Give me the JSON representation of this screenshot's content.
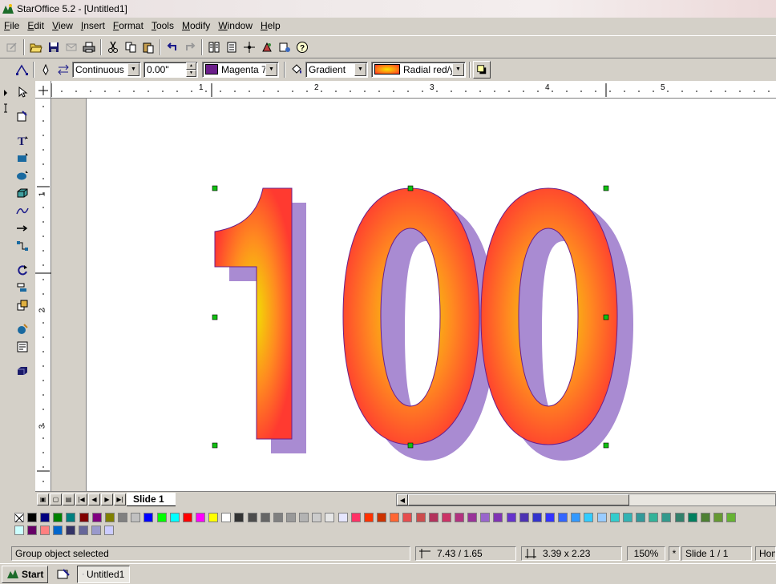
{
  "window": {
    "title": "StarOffice 5.2 - [Untitled1]"
  },
  "menu": {
    "items": [
      {
        "key": "F",
        "rest": "ile"
      },
      {
        "key": "E",
        "rest": "dit"
      },
      {
        "key": "V",
        "rest": "iew"
      },
      {
        "key": "I",
        "rest": "nsert"
      },
      {
        "key": "F",
        "rest": "ormat"
      },
      {
        "key": "T",
        "rest": "ools"
      },
      {
        "key": "M",
        "rest": "odify"
      },
      {
        "key": "W",
        "rest": "indow"
      },
      {
        "key": "H",
        "rest": "elp"
      }
    ]
  },
  "object_bar": {
    "line_style": "Continuous",
    "line_width": "0.00\"",
    "line_color": "Magenta 7",
    "line_color_hex": "#6b1e8a",
    "area_style": "Gradient",
    "area_fill": "Radial red/y"
  },
  "ruler": {
    "h_labels": [
      "1",
      "2",
      "3",
      "4",
      "5"
    ],
    "v_labels": [
      "1",
      "2",
      "3"
    ]
  },
  "drawing": {
    "text": "100",
    "gradient_center": "#f0e800",
    "gradient_mid": "#ff8a20",
    "gradient_edge": "#ff3a30",
    "shadow_color": "#a98bd2",
    "outline_color": "#6b1e8a"
  },
  "tabs": {
    "active": "Slide 1"
  },
  "palette": {
    "row1": [
      "#000000",
      "#000080",
      "#008000",
      "#008080",
      "#800000",
      "#800080",
      "#808000",
      "#808080",
      "#c0c0c0",
      "#0000ff",
      "#00ff00",
      "#00ffff",
      "#ff0000",
      "#ff00ff",
      "#ffff00",
      "#ffffff",
      "#333333",
      "#4d4d4d",
      "#666666",
      "#808080",
      "#999999",
      "#b3b3b3",
      "#cccccc",
      "#e6e6e6",
      "#e6e6ff",
      "#ff3366",
      "#ff3300",
      "#cc3300",
      "#ff6633",
      "#e64d4d",
      "#cc4d4d",
      "#b3335c",
      "#cc3366",
      "#b3337f",
      "#993399",
      "#9966cc",
      "#8033b3",
      "#6633cc",
      "#4d33b3",
      "#3333cc",
      "#3333ff",
      "#3366ff",
      "#3399ff",
      "#33ccff",
      "#99ccff",
      "#33cccc",
      "#33b3b3",
      "#339999",
      "#33b399",
      "#33998c",
      "#33806b",
      "#007f5f",
      "#4d8033",
      "#669933",
      "#66b333"
    ],
    "row2": [
      "#ccffff",
      "#660066",
      "#ff8080",
      "#0066cc",
      "#333366",
      "#666699",
      "#9999cc",
      "#ccccff"
    ]
  },
  "status": {
    "message": "Group object selected",
    "position": "7.43 / 1.65",
    "size": "3.39 x 2.23",
    "zoom": "150%",
    "modified": "*",
    "page": "Slide 1 / 1",
    "layout": "Hom"
  },
  "taskbar": {
    "start": "Start",
    "window_button": "Untitled1"
  }
}
